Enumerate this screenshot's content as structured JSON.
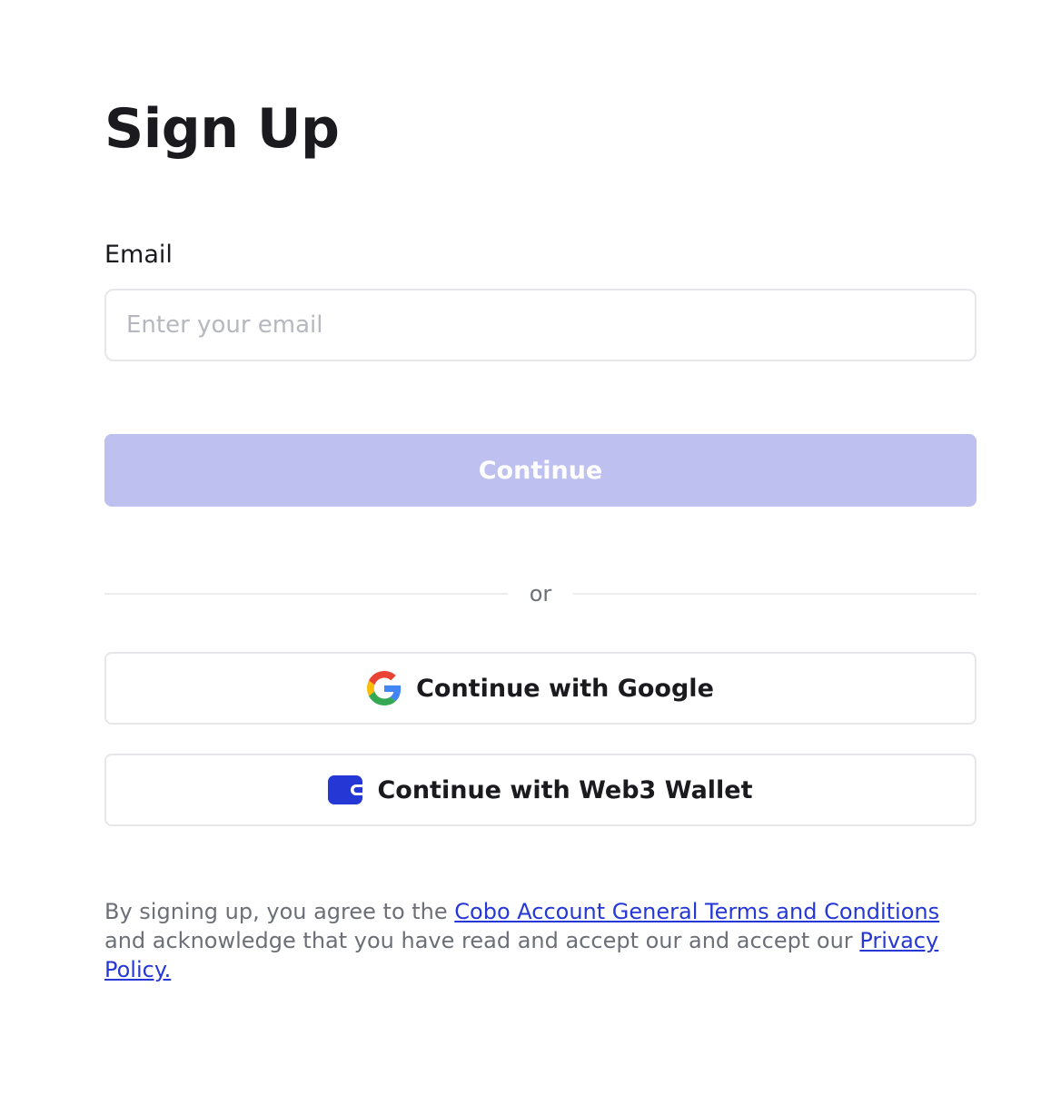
{
  "page": {
    "title": "Sign Up"
  },
  "email": {
    "label": "Email",
    "value": "",
    "placeholder": "Enter your email"
  },
  "continue_button": {
    "label": "Continue",
    "state": "disabled",
    "color": "#BEC1F0"
  },
  "divider": {
    "text": "or"
  },
  "social": {
    "google": {
      "label": "Continue with Google",
      "icon": "google-icon"
    },
    "web3": {
      "label": "Continue with Web3 Wallet",
      "icon": "wallet-icon",
      "icon_color": "#2538D6"
    }
  },
  "legal": {
    "prefix": "By signing up, you agree to the ",
    "terms_link": "Cobo Account General Terms and Conditions",
    "middle": " and acknowledge that you have read and accept our and accept our ",
    "privacy_link": "Privacy Policy."
  },
  "colors": {
    "link": "#2538D6",
    "text_primary": "#1B1B1F",
    "text_secondary": "#6C6F78",
    "border": "#E6E7EA"
  }
}
